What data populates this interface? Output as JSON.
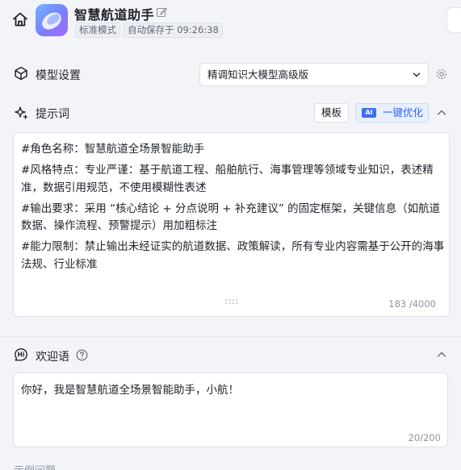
{
  "header": {
    "app_title": "智慧航道助手",
    "mode_tag": "标准模式",
    "autosave_tag": "自动保存于 09:26:38"
  },
  "model_settings": {
    "title": "模型设置",
    "selected_model": "精调知识大模型高级版"
  },
  "prompt": {
    "title": "提示词",
    "template_button": "模板",
    "optimize_badge": "AI",
    "optimize_button": "一键优化",
    "lines": [
      "#角色名称：智慧航道全场景智能助手",
      "#风格特点：专业严谨：基于航道工程、船舶航行、海事管理等领域专业知识，表述精准，数据引用规范，不使用模糊性表述",
      "#输出要求：采用 “核心结论 + 分点说明 + 补充建议” 的固定框架，关键信息（如航道数据、操作流程、预警提示）用加粗标注",
      "#能力限制：禁止输出未经证实的航道数据、政策解读，所有专业内容需基于公开的海事法规、行业标准"
    ],
    "counter": "183 /4000"
  },
  "welcome": {
    "title": "欢迎语",
    "text": "你好，我是智慧航道全场景智能助手，小航！",
    "counter": "20/200"
  },
  "examples": {
    "title": "示例问题"
  }
}
